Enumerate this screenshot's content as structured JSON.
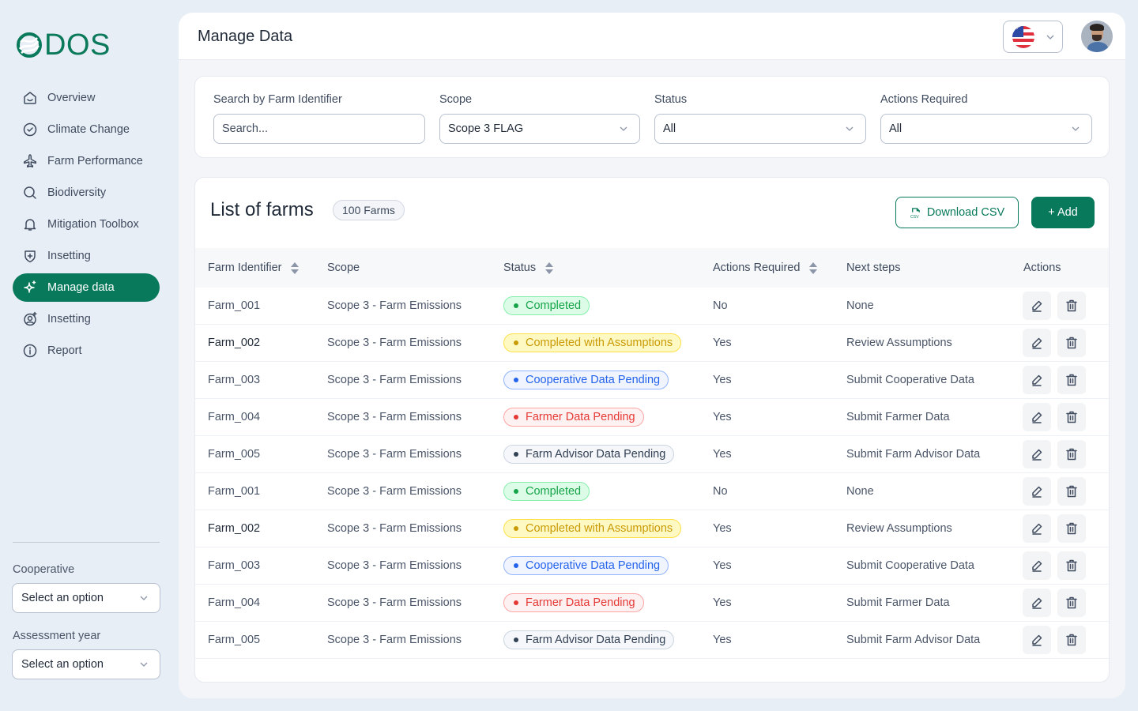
{
  "brand": {
    "name": "DOS",
    "color": "#087a5b"
  },
  "sidebar": {
    "items": [
      {
        "label": "Overview",
        "icon": "home-icon",
        "active": false
      },
      {
        "label": "Climate Change",
        "icon": "check-circle-icon",
        "active": false
      },
      {
        "label": "Farm Performance",
        "icon": "airplane-icon",
        "active": false
      },
      {
        "label": "Biodiversity",
        "icon": "search-icon",
        "active": false
      },
      {
        "label": "Mitigation Toolbox",
        "icon": "bell-icon",
        "active": false
      },
      {
        "label": "Insetting",
        "icon": "shield-plus-icon",
        "active": false
      },
      {
        "label": "Manage data",
        "icon": "sparkle-icon",
        "active": true
      },
      {
        "label": "Insetting",
        "icon": "user-plus-icon",
        "active": false
      },
      {
        "label": "Report",
        "icon": "info-icon",
        "active": false
      }
    ],
    "cooperative": {
      "label": "Cooperative",
      "value": "Select an option"
    },
    "assessment_year": {
      "label": "Assessment year",
      "value": "Select an option"
    }
  },
  "header": {
    "title": "Manage Data",
    "language": "us-flag-icon"
  },
  "filters": {
    "search": {
      "label": "Search by Farm Identifier",
      "placeholder": "Search..."
    },
    "scope": {
      "label": "Scope",
      "value": "Scope 3 FLAG"
    },
    "status": {
      "label": "Status",
      "value": "All"
    },
    "actions_required": {
      "label": "Actions Required",
      "value": "All"
    }
  },
  "list": {
    "title": "List of farms",
    "count": "100 Farms",
    "download_label": "Download CSV",
    "add_label": "+ Add",
    "columns": [
      "Farm Identifier",
      "Scope",
      "Status",
      "Actions Required",
      "Next steps",
      "Actions"
    ],
    "status_styles": {
      "Completed": {
        "fg": "#16a34a",
        "bg": "#dcfce7",
        "border": "#86efac"
      },
      "Completed with Assumptions": {
        "fg": "#ca9a04",
        "bg": "#fef9c3",
        "border": "#fde047"
      },
      "Cooperative Data Pending": {
        "fg": "#2563eb",
        "bg": "#eff4ff",
        "border": "#93b4fb"
      },
      "Farmer Data Pending": {
        "fg": "#e53935",
        "bg": "#fef1f1",
        "border": "#fca5a5"
      },
      "Farm Advisor Data Pending": {
        "fg": "#334155",
        "bg": "#f5f7fa",
        "border": "#cbd5e1"
      }
    },
    "rows": [
      {
        "id": "Farm_001",
        "scope": "Scope 3 - Farm Emissions",
        "status": "Completed",
        "actions_required": "No",
        "next_steps": "None"
      },
      {
        "id": "Farm_002",
        "scope": "Scope 3 - Farm Emissions",
        "status": "Completed with Assumptions",
        "actions_required": "Yes",
        "next_steps": "Review Assumptions"
      },
      {
        "id": "Farm_003",
        "scope": "Scope 3 - Farm Emissions",
        "status": "Cooperative Data Pending",
        "actions_required": "Yes",
        "next_steps": "Submit Cooperative Data"
      },
      {
        "id": "Farm_004",
        "scope": "Scope 3 - Farm Emissions",
        "status": "Farmer Data Pending",
        "actions_required": "Yes",
        "next_steps": "Submit Farmer Data"
      },
      {
        "id": "Farm_005",
        "scope": "Scope 3 - Farm Emissions",
        "status": "Farm Advisor Data Pending",
        "actions_required": "Yes",
        "next_steps": "Submit Farm Advisor Data"
      },
      {
        "id": "Farm_001",
        "scope": "Scope 3 - Farm Emissions",
        "status": "Completed",
        "actions_required": "No",
        "next_steps": "None"
      },
      {
        "id": "Farm_002",
        "scope": "Scope 3 - Farm Emissions",
        "status": "Completed with Assumptions",
        "actions_required": "Yes",
        "next_steps": "Review Assumptions"
      },
      {
        "id": "Farm_003",
        "scope": "Scope 3 - Farm Emissions",
        "status": "Cooperative Data Pending",
        "actions_required": "Yes",
        "next_steps": "Submit Cooperative Data"
      },
      {
        "id": "Farm_004",
        "scope": "Scope 3 - Farm Emissions",
        "status": "Farmer Data Pending",
        "actions_required": "Yes",
        "next_steps": "Submit Farmer Data"
      },
      {
        "id": "Farm_005",
        "scope": "Scope 3 - Farm Emissions",
        "status": "Farm Advisor Data Pending",
        "actions_required": "Yes",
        "next_steps": "Submit Farm Advisor Data"
      }
    ]
  }
}
